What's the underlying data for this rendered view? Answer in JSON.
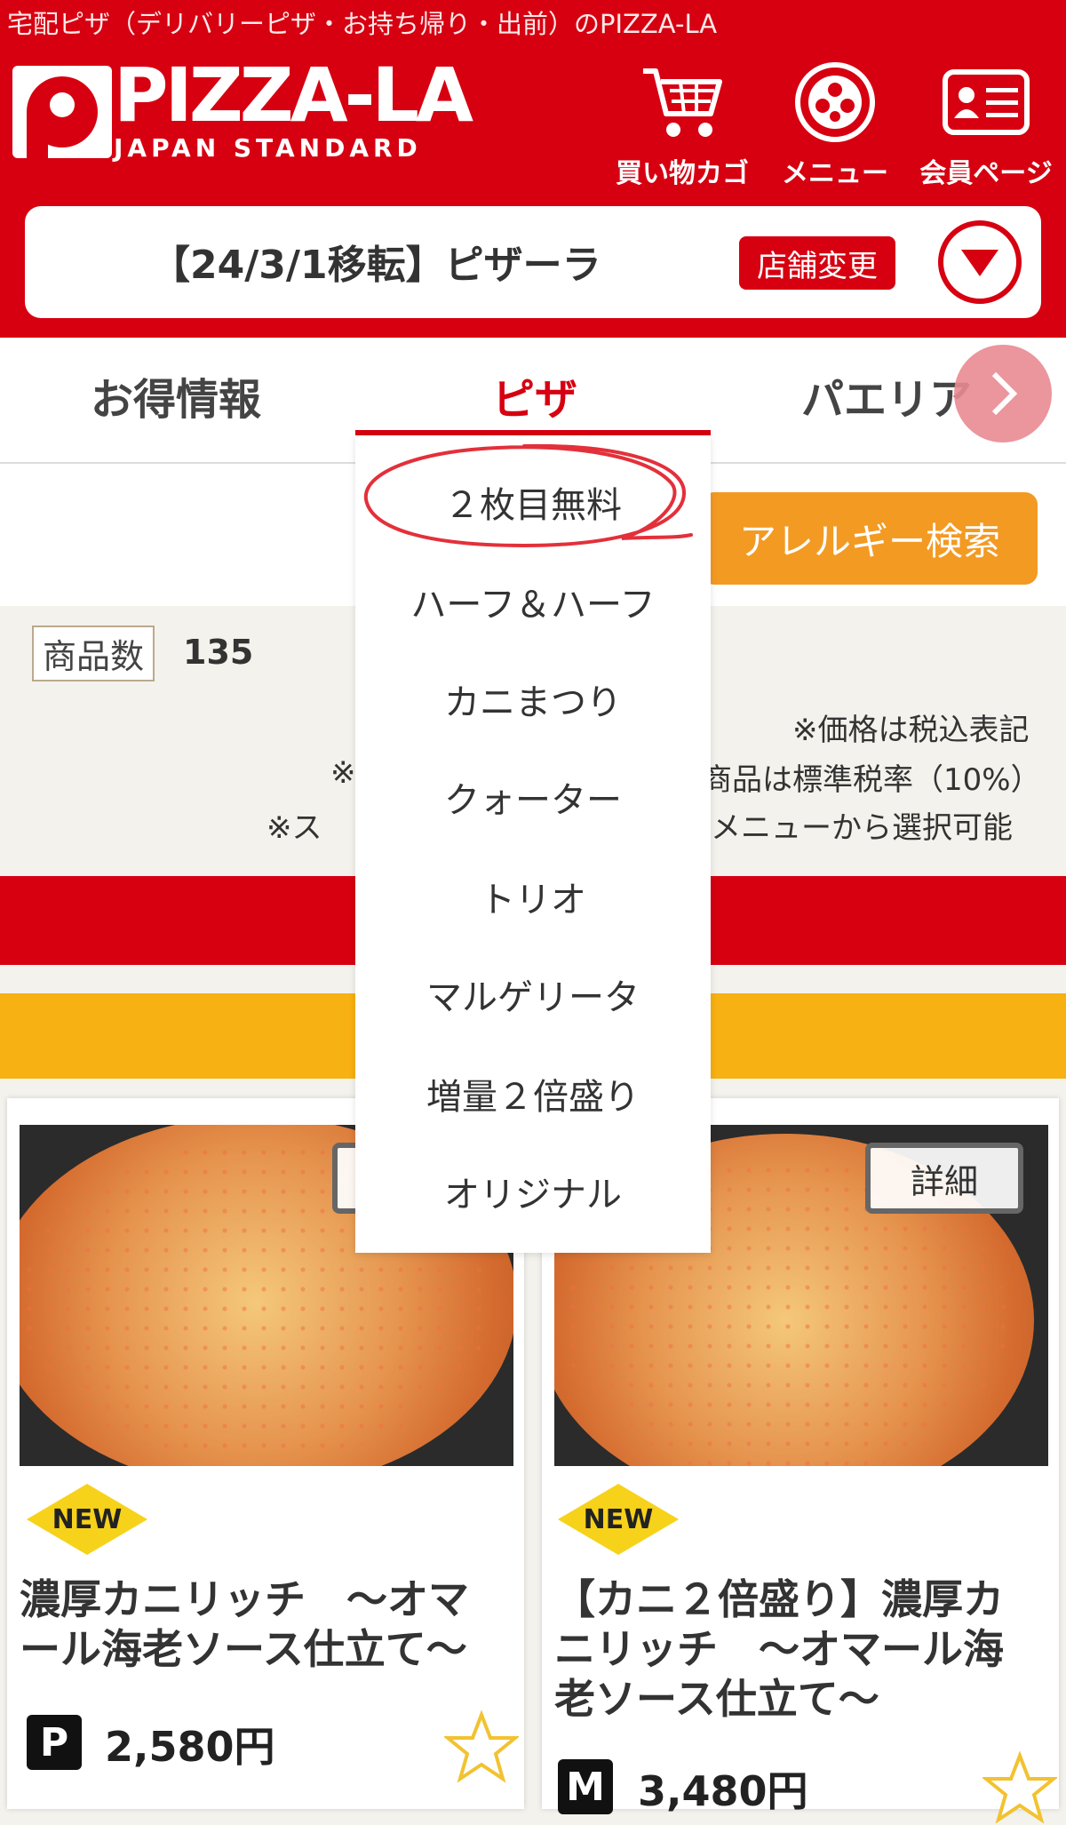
{
  "header": {
    "seo_text": "宅配ピザ（デリバリーピザ・お持ち帰り・出前）のPIZZA-LA",
    "logo_text": "PIZZA-LA",
    "logo_sub": "JAPAN STANDARD",
    "brand_color": "#d60011",
    "nav": [
      {
        "label": "買い物カゴ",
        "icon": "cart-icon"
      },
      {
        "label": "メニュー",
        "icon": "pizza-menu-icon"
      },
      {
        "label": "会員ページ",
        "icon": "member-card-icon"
      }
    ]
  },
  "store": {
    "name": "【24/3/1移転】ピザーラ",
    "change_label": "店舗変更"
  },
  "tabs": [
    {
      "label": "お得情報",
      "active": false
    },
    {
      "label": "ピザ",
      "active": true
    },
    {
      "label": "パエリア",
      "active": false
    }
  ],
  "filter": {
    "allergy_label": "アレルギー検索",
    "allergy_color": "#f39a23"
  },
  "count": {
    "label": "商品数",
    "value": "135"
  },
  "notes": {
    "tax_display": "※価格は税込表記",
    "tax_rate_fragment": "商品は標準税率（10%）",
    "tax_left_fragment": "※",
    "select_left_fragment": "※ス",
    "select_right_fragment": "メニューから選択可能"
  },
  "dropdown": {
    "items": [
      "２枚目無料",
      "ハーフ＆ハーフ",
      "カニまつり",
      "クォーター",
      "トリオ",
      "マルゲリータ",
      "増量２倍盛り",
      "オリジナル"
    ],
    "highlighted_index": 0
  },
  "products": [
    {
      "badge": "NEW",
      "title": "濃厚カニリッチ　～オマール海老ソース仕立て～",
      "size": "P",
      "price": "2,580円"
    },
    {
      "badge": "NEW",
      "detail_label": "詳細",
      "title": "【カニ２倍盛り】濃厚カニリッチ　～オマール海老ソース仕立て～",
      "size": "M",
      "price": "3,480円"
    }
  ]
}
